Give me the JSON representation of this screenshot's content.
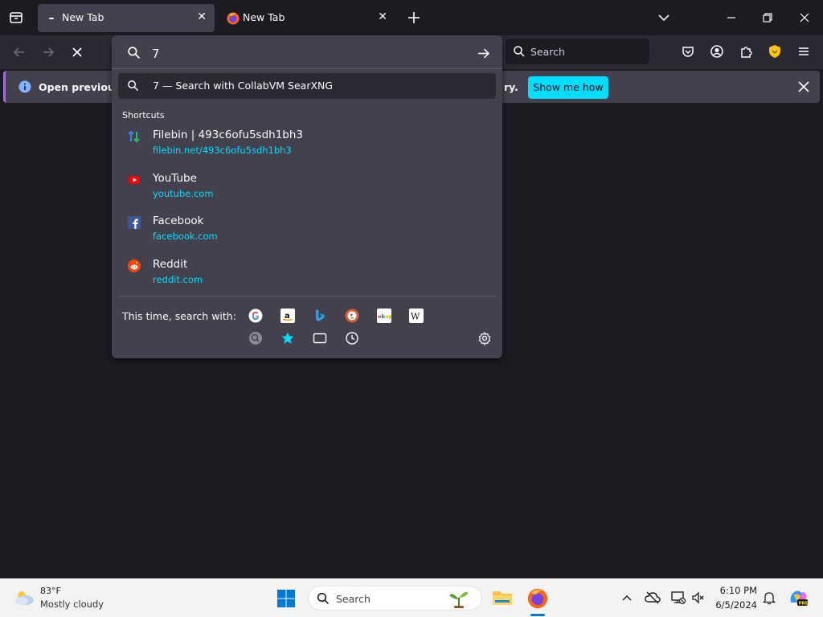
{
  "tabs": [
    {
      "title": "New Tab",
      "active": true
    },
    {
      "title": "New Tab",
      "active": false
    }
  ],
  "urlbar": {
    "value": "7",
    "suggestion_text": "7 — Search with CollabVM SearXNG"
  },
  "shortcuts": {
    "heading": "Shortcuts",
    "items": [
      {
        "title": "Filebin | 493c6ofu5sdh1bh3",
        "url": "filebin.net/493c6ofu5sdh1bh3",
        "icon": "filebin-icon"
      },
      {
        "title": "YouTube",
        "url": "youtube.com",
        "icon": "youtube-icon"
      },
      {
        "title": "Facebook",
        "url": "facebook.com",
        "icon": "facebook-icon"
      },
      {
        "title": "Reddit",
        "url": "reddit.com",
        "icon": "reddit-icon"
      }
    ]
  },
  "search_with": {
    "label": "This time, search with:",
    "engines": [
      "google-icon",
      "amazon-icon",
      "bing-icon",
      "duckduckgo-icon",
      "ebay-icon",
      "wikipedia-icon",
      "searxng-icon",
      "bookmarks-icon",
      "tabs-icon",
      "history-icon"
    ]
  },
  "search": {
    "placeholder": "Search"
  },
  "notification": {
    "text": "Open previous tab",
    "tail": "ry.",
    "button": "Show me how"
  },
  "taskbar": {
    "temperature": "83°F",
    "weather": "Mostly cloudy",
    "search_placeholder": "Search",
    "time": "6:10 PM",
    "date": "6/5/2024"
  },
  "colors": {
    "accent": "#00ddff",
    "popup": "#42414d",
    "chrome": "#2b2a33",
    "bg": "#1c1b22"
  }
}
